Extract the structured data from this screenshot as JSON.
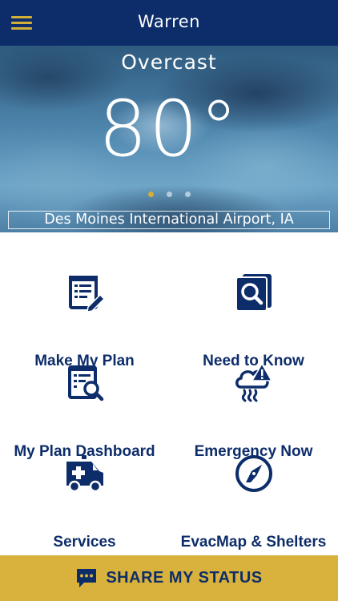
{
  "header": {
    "title": "Warren",
    "menu_icon": "hamburger-menu-icon"
  },
  "weather": {
    "condition": "Overcast",
    "temperature": "80°",
    "location": "Des Moines International Airport, IA",
    "pager": {
      "count": 3,
      "active_index": 0
    }
  },
  "menu": {
    "items": [
      {
        "label": "Make My Plan",
        "icon": "plan-edit-icon"
      },
      {
        "label": "Need to Know",
        "icon": "search-document-icon"
      },
      {
        "label": "My Plan Dashboard",
        "icon": "plan-dashboard-icon"
      },
      {
        "label": "Emergency Now",
        "icon": "storm-alert-icon"
      },
      {
        "label": "Services",
        "icon": "ambulance-icon"
      },
      {
        "label": "EvacMap & Shelters",
        "icon": "compass-icon"
      }
    ]
  },
  "share_status": {
    "label": "SHARE MY STATUS",
    "icon": "chat-bubble-icon"
  },
  "colors": {
    "navy": "#0d2d6a",
    "gold": "#d8b23c",
    "background": "#ffffff"
  }
}
